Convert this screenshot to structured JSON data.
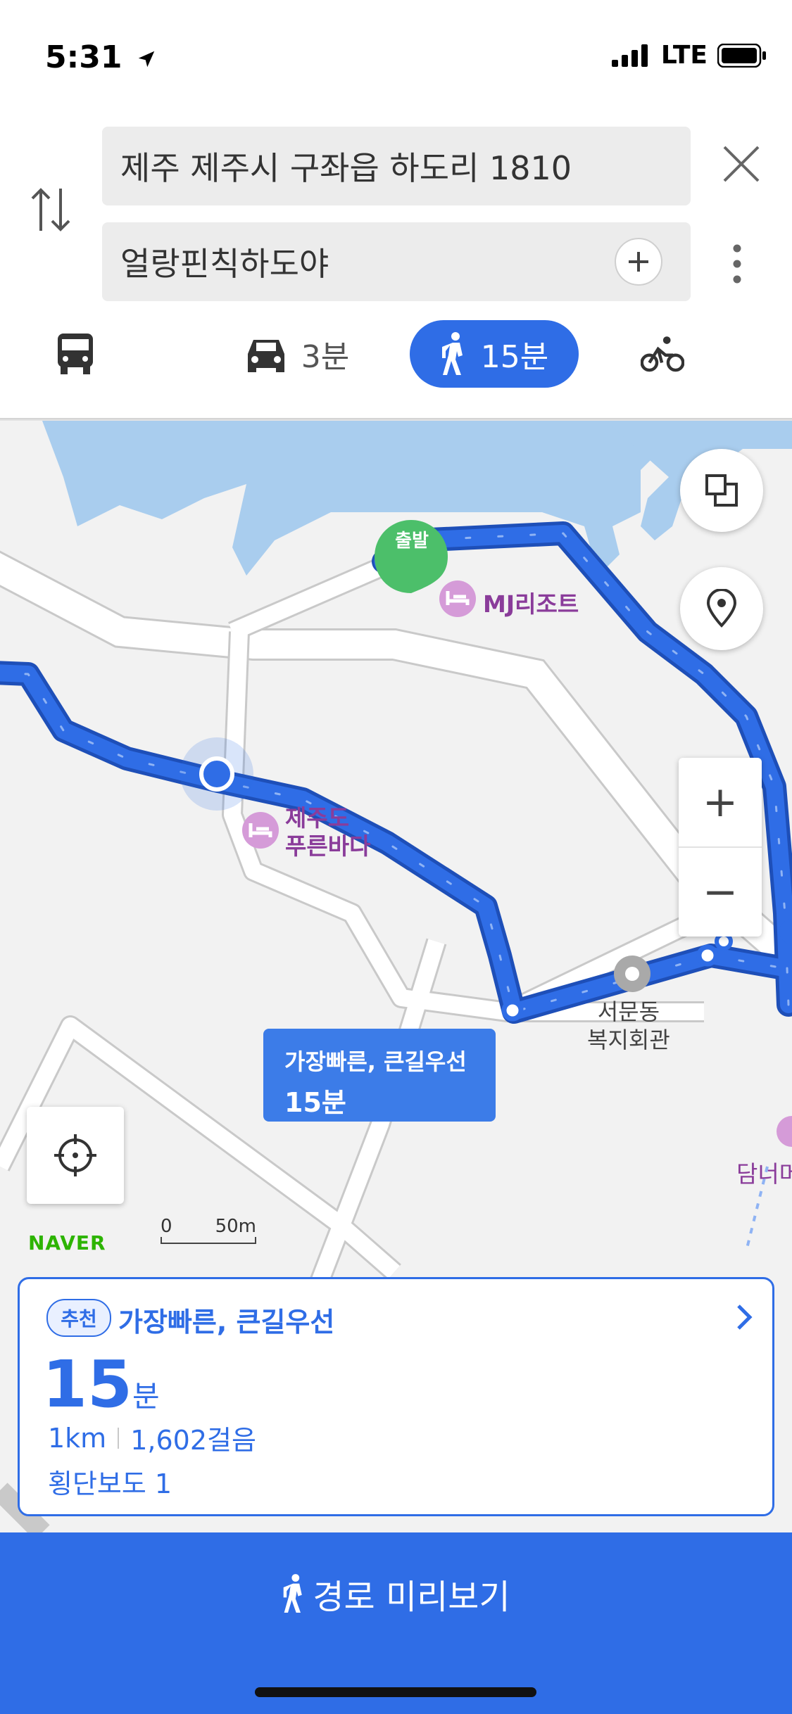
{
  "status_bar": {
    "time": "5:31",
    "network": "LTE"
  },
  "search": {
    "origin": "제주 제주시 구좌읍 하도리 1810",
    "destination": "얼랑핀칙하도야"
  },
  "modes": [
    {
      "name": "transit",
      "label": ""
    },
    {
      "name": "car",
      "label": "3분"
    },
    {
      "name": "walk",
      "label": "15분",
      "active": true
    },
    {
      "name": "bike",
      "label": ""
    }
  ],
  "map": {
    "start_marker": "출발",
    "pois": {
      "mj_resort": "MJ리조트",
      "jeju_blue_line1": "제주도",
      "jeju_blue_line2": "푸른바다",
      "seomun_line1": "서문동",
      "seomun_line2": "복지회관",
      "damn": "담너머"
    },
    "route_label": {
      "line1": "가장빠른, 큰길우선",
      "line2": "15분"
    },
    "brand": "NAVER",
    "scale": {
      "zero": "0",
      "dist": "50m"
    },
    "zoom_in": "+",
    "zoom_out": "−"
  },
  "route_card": {
    "badge": "추천",
    "title": "가장빠른, 큰길우선",
    "duration_value": "15",
    "duration_unit": "분",
    "distance": "1km",
    "steps": "1,602걸음",
    "crosswalks": "횡단보도 1"
  },
  "bottom_button": {
    "label": "경로 미리보기"
  },
  "colors": {
    "accent": "#2f6de6",
    "route": "#2f6de6",
    "start": "#4cbf6a",
    "poi": "#8a3c9a"
  }
}
